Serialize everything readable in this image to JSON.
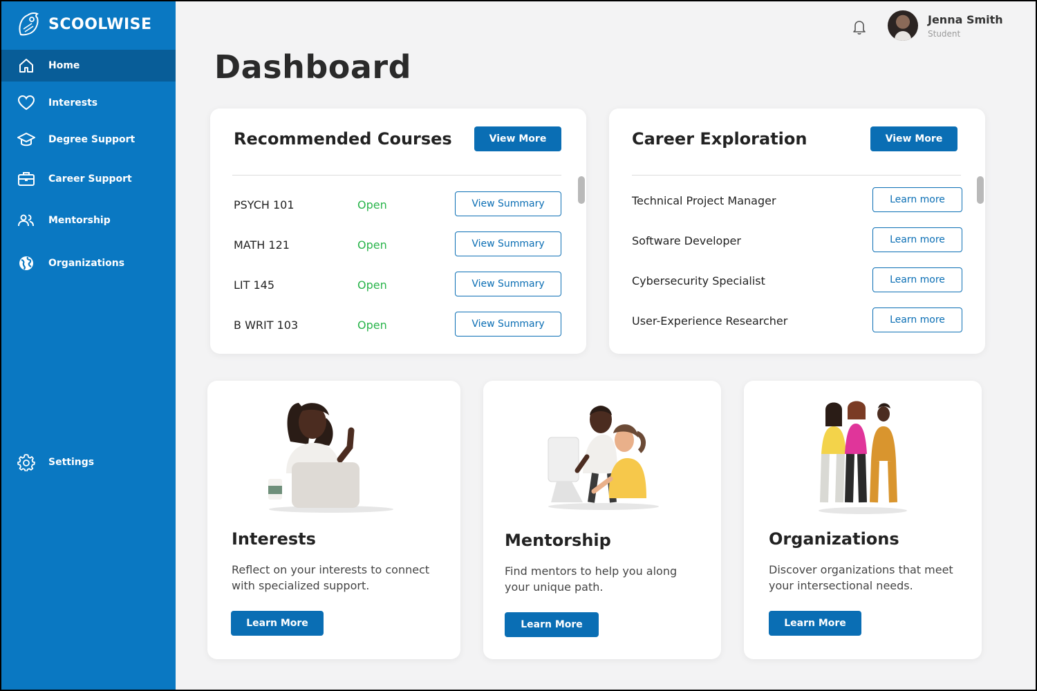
{
  "app": {
    "name": "SCOOLWISE"
  },
  "colors": {
    "brand": "#0a78c2",
    "brand_dark": "#085d98",
    "button": "#0a6eb4",
    "status_open": "#28b44a"
  },
  "sidebar": {
    "items": [
      {
        "label": "Home",
        "icon": "home-icon",
        "active": true
      },
      {
        "label": "Interests",
        "icon": "heart-icon"
      },
      {
        "label": "Degree Support",
        "icon": "graduation-cap-icon"
      },
      {
        "label": "Career Support",
        "icon": "briefcase-icon"
      },
      {
        "label": "Mentorship",
        "icon": "people-icon"
      },
      {
        "label": "Organizations",
        "icon": "globe-icon"
      }
    ],
    "settings": {
      "label": "Settings",
      "icon": "gear-icon"
    }
  },
  "header": {
    "notification_icon": "bell-icon",
    "user": {
      "name": "Jenna Smith",
      "role": "Student"
    }
  },
  "page": {
    "title": "Dashboard"
  },
  "courses": {
    "title": "Recommended Courses",
    "view_more": "View More",
    "rows": [
      {
        "code": "PSYCH 101",
        "status": "Open",
        "action": "View Summary"
      },
      {
        "code": "MATH 121",
        "status": "Open",
        "action": "View Summary"
      },
      {
        "code": "LIT 145",
        "status": "Open",
        "action": "View Summary"
      },
      {
        "code": "B WRIT 103",
        "status": "Open",
        "action": "View Summary"
      }
    ]
  },
  "careers": {
    "title": "Career Exploration",
    "view_more": "View More",
    "rows": [
      {
        "name": "Technical Project Manager",
        "action": "Learn more"
      },
      {
        "name": "Software Developer",
        "action": "Learn more"
      },
      {
        "name": "Cybersecurity Specialist",
        "action": "Learn more"
      },
      {
        "name": "User-Experience Researcher",
        "action": "Learn more"
      }
    ]
  },
  "features": [
    {
      "title": "Interests",
      "description": "Reflect on your interests to connect with specialized support.",
      "button": "Learn More"
    },
    {
      "title": "Mentorship",
      "description": "Find mentors to help you along your unique path.",
      "button": "Learn More"
    },
    {
      "title": "Organizations",
      "description": "Discover organizations that meet your intersectional needs.",
      "button": "Learn More"
    }
  ]
}
